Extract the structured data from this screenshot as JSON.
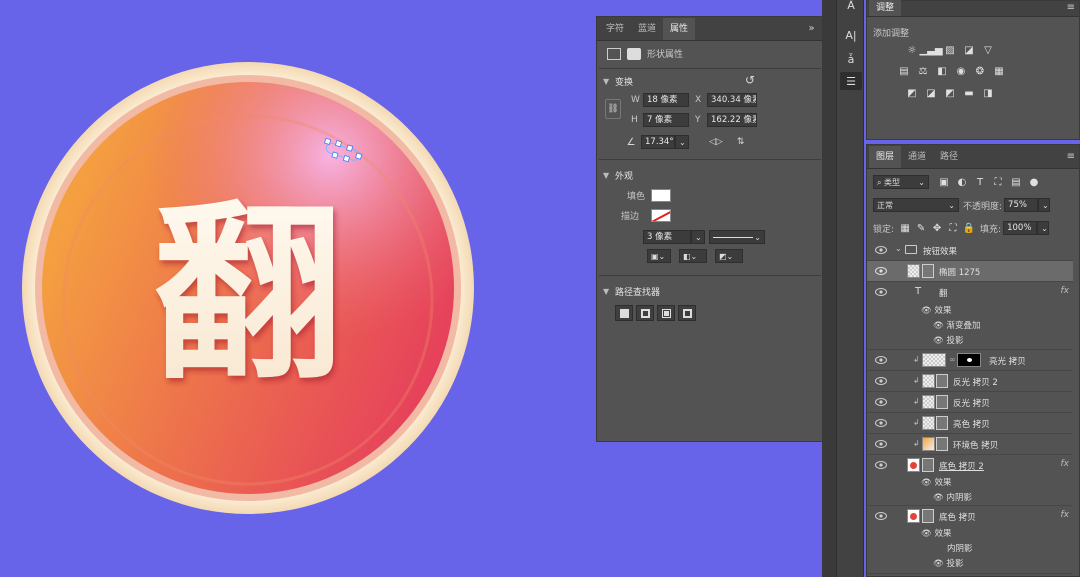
{
  "canvas": {
    "background": "#6864ea",
    "button_glyph": "翻",
    "button_colors": {
      "outer_ring": "#fdf0d6",
      "inner_start": "#f3a041",
      "inner_end": "#e8415a",
      "highlight": "#f5a0e0"
    }
  },
  "properties_panel": {
    "tabs": [
      "字符",
      "蓝道",
      "属性"
    ],
    "active_tab": "属性",
    "collapse_glyph": "»",
    "menu_glyph": "≡",
    "header_label": "形状属性",
    "transform": {
      "title": "变换",
      "w_label": "W",
      "w_value": "18 像素",
      "x_label": "X",
      "x_value": "340.34 像素",
      "h_label": "H",
      "h_value": "7 像素",
      "y_label": "Y",
      "y_value": "162.22 像素",
      "angle_value": "17.34°"
    },
    "appearance": {
      "title": "外观",
      "fill_label": "填色",
      "stroke_label": "描边",
      "stroke_width": "3 像素"
    },
    "pathfinder": {
      "title": "路径查找器"
    }
  },
  "tools": {
    "items": [
      "A-icon",
      "char-panel-icon",
      "paragraph-icon",
      "adjust-icon"
    ]
  },
  "adjustments_panel": {
    "tab": "调整",
    "add_label": "添加调整"
  },
  "layers_panel": {
    "tabs": [
      "图层",
      "通道",
      "路径"
    ],
    "active_tab": "图层",
    "filter_label": "类型",
    "blend_mode": "正常",
    "opacity_label": "不透明度:",
    "opacity_value": "75%",
    "lock_label": "锁定:",
    "fill_label": "填充:",
    "fill_value": "100%",
    "group_name": "按钮效果",
    "layers": [
      {
        "name": "椭圆 1275",
        "selected": true
      },
      {
        "name": "翻",
        "type": "text",
        "fx": "fx"
      },
      {
        "name": "亮光 拷贝"
      },
      {
        "name": "反光 拷贝 2"
      },
      {
        "name": "反光 拷贝"
      },
      {
        "name": "亮色 拷贝"
      },
      {
        "name": "环境色 拷贝"
      },
      {
        "name": "底色 拷贝 2",
        "fx": "fx"
      },
      {
        "name": "底色 拷贝",
        "fx": "fx"
      }
    ],
    "effects_label": "效果",
    "effect_gradient": "渐变叠加",
    "effect_shadow": "投影",
    "effect_inner_shadow": "内阴影"
  }
}
